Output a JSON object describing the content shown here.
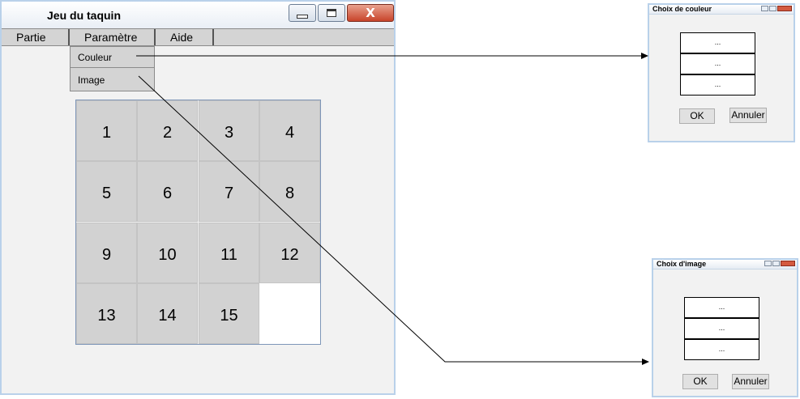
{
  "main_window": {
    "title": "Jeu du taquin",
    "close_symbol": "X",
    "menu": [
      "Partie",
      "Paramètre",
      "Aide"
    ],
    "dropdown": [
      "Couleur",
      "Image"
    ]
  },
  "puzzle": {
    "tiles": [
      "1",
      "2",
      "3",
      "4",
      "5",
      "6",
      "7",
      "8",
      "9",
      "10",
      "11",
      "12",
      "13",
      "14",
      "15",
      ""
    ]
  },
  "dialog_couleur": {
    "title": "Choix de couleur",
    "options": [
      "...",
      "...",
      "..."
    ],
    "ok": "OK",
    "cancel": "Annuler"
  },
  "dialog_image": {
    "title": "Choix d'image",
    "options": [
      "...",
      "...",
      "..."
    ],
    "ok": "OK",
    "cancel": "Annuler"
  }
}
